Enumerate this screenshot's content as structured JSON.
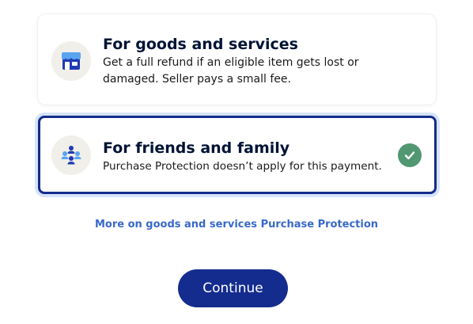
{
  "options": {
    "goods": {
      "title": "For goods and services",
      "description": "Get a full refund if an eligible item gets lost or damaged. Seller pays a small fee.",
      "icon": "storefront-icon",
      "selected": false
    },
    "friends": {
      "title": "For friends and family",
      "description": "Purchase Protection doesn’t apply for this payment.",
      "icon": "people-icon",
      "selected": true
    }
  },
  "learn_more_link": "More on goods and services Purchase Protection",
  "continue_label": "Continue",
  "colors": {
    "brand_navy": "#142c8e",
    "selected_ring": "#d6e4fa",
    "link_blue": "#3869c9",
    "check_green": "#519872",
    "icon_bg": "#f1efea"
  }
}
